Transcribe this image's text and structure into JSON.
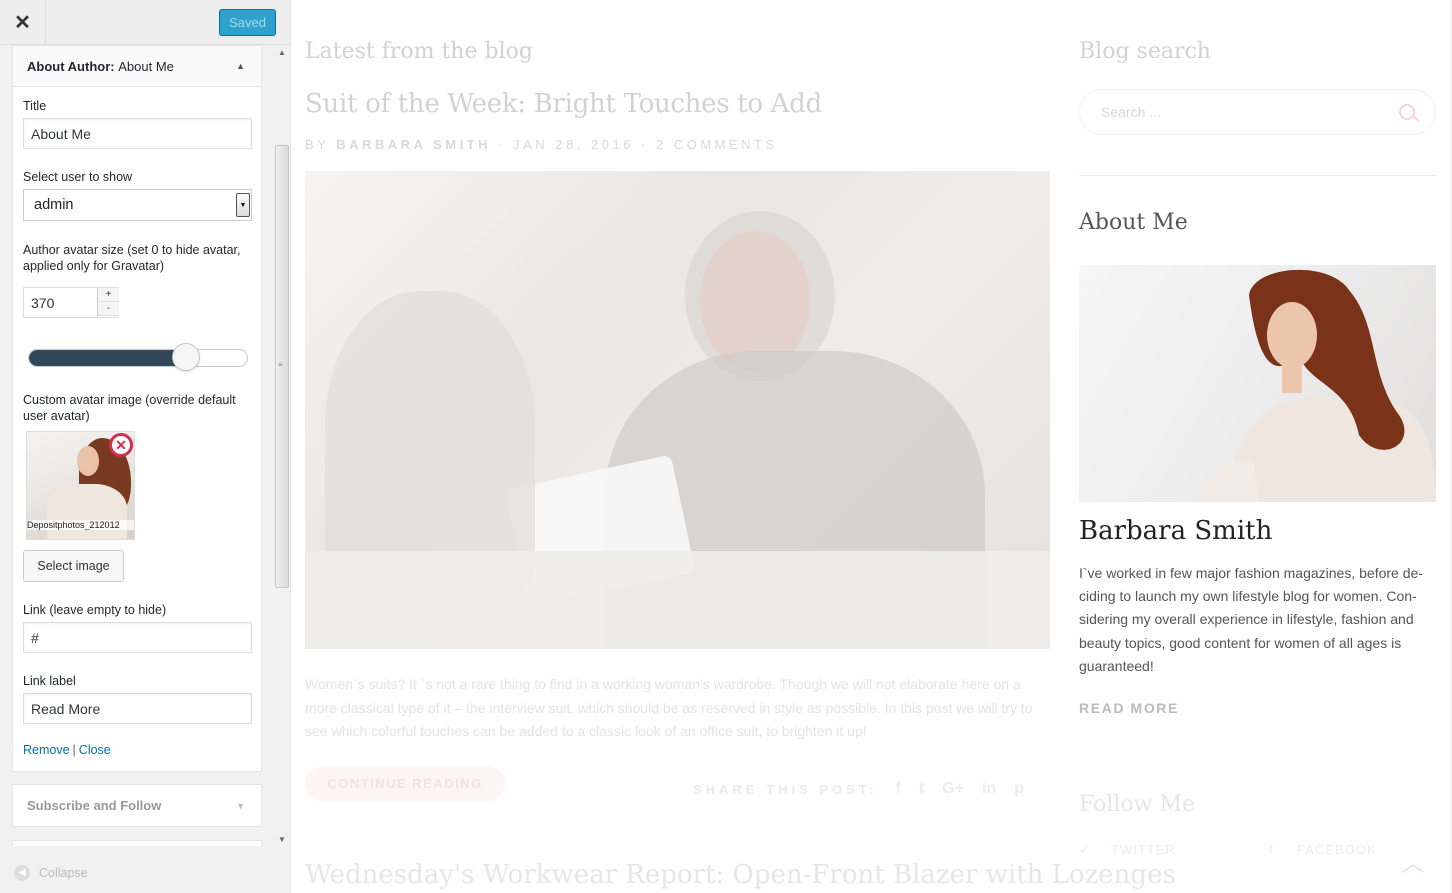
{
  "customizer": {
    "close_icon": "close-icon",
    "saved_label": "Saved",
    "widget": {
      "title_prefix": "About Author:",
      "title_name": "About Me",
      "fields": {
        "title_label": "Title",
        "title_value": "About Me",
        "user_label": "Select user to show",
        "user_value": "admin",
        "avatar_size_label": "Author avatar size (set 0 to hide avatar, applied only for Gravatar)",
        "avatar_size_value": "370",
        "spin_up": "+",
        "spin_down": "-",
        "slider_fraction": 0.72,
        "custom_avatar_label": "Custom avatar image (override default user avatar)",
        "image_caption": "Depositphotos_212012",
        "select_image_label": "Select image",
        "link_label": "Link (leave empty to hide)",
        "link_value": "#",
        "link_label_label": "Link label",
        "link_label_value": "Read More"
      },
      "remove_label": "Remove",
      "separator": "|",
      "close_label": "Close"
    },
    "next_widget_title": "Subscribe and Follow",
    "collapse_label": "Collapse"
  },
  "preview": {
    "blog_heading": "Latest from the blog",
    "post": {
      "title": "Suit of the Week: Bright Touches to Add",
      "meta_by": "BY",
      "meta_author": "BARBARA SMITH",
      "meta_dot1": "·",
      "meta_date": "JAN 28, 2016",
      "meta_dot2": "·",
      "meta_comments": "2 COMMENTS",
      "excerpt": "Women`s suits? It `s not a rare thing to find in a working woman's wardrobe. Though we will not elaborate here on a more classical type of it – the interview suit, which should be as reserved in style as possible. In this post we will try to see which colorful touches can be added to a classic look of an office suit, to brighten it up!",
      "continue_label": "CONTINUE READING",
      "share_label": "SHARE THIS POST:",
      "share_icons": [
        "f",
        "t",
        "G+",
        "in",
        "p"
      ]
    },
    "next_post_title": "Wednesday's Workwear Report: Open-Front Blazer with Lozenges",
    "sidebar": {
      "search_heading": "Blog search",
      "search_placeholder": "Search ...",
      "about_heading": "About Me",
      "author_name": "Barbara Smith",
      "author_bio": "I`ve worked in few major fashion magazines, before de-ciding to launch my own lifestyle blog for women. Con-sidering my overall experience in lifestyle, fashion and beauty topics, good content for women of all ages is guaranteed!",
      "read_more": "READ MORE",
      "follow_heading": "Follow Me",
      "follow_links": [
        "TWITTER",
        "FACEBOOK"
      ]
    }
  }
}
